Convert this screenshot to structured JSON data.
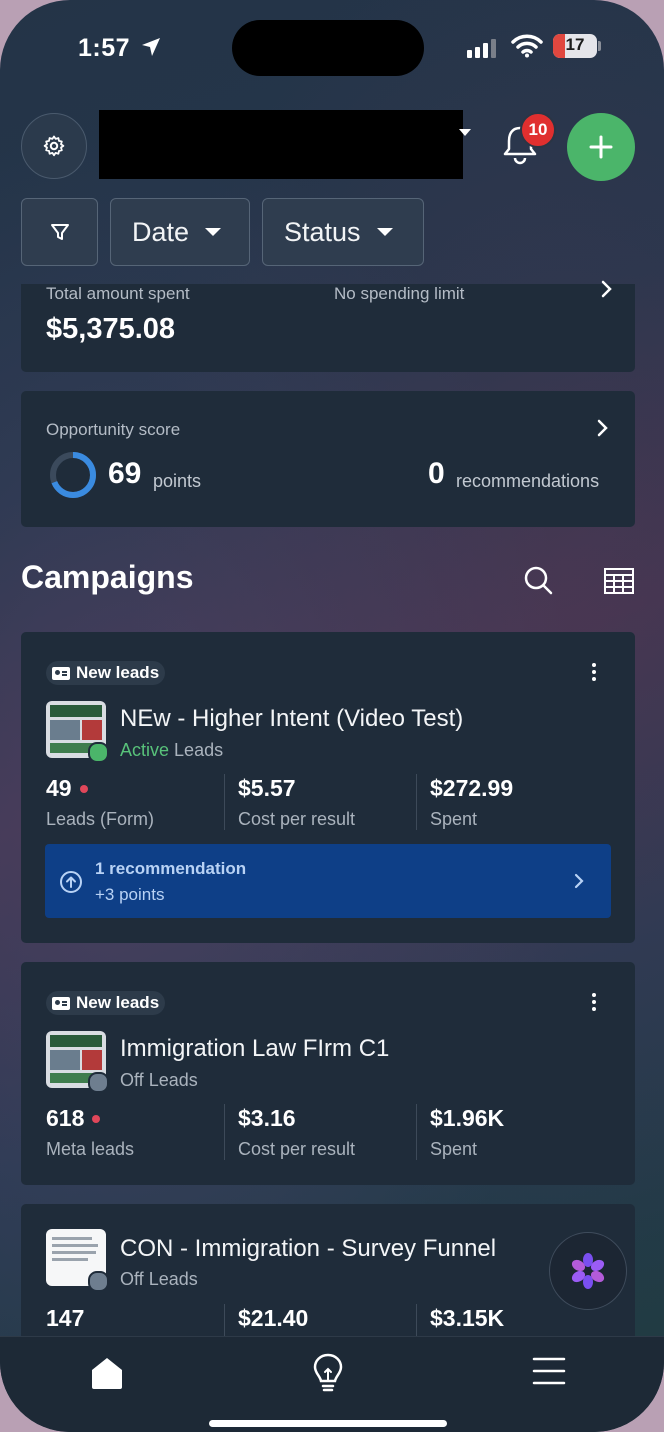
{
  "status_bar": {
    "time": "1:57",
    "battery": "17"
  },
  "header": {
    "notifications_count": "10"
  },
  "filters": {
    "date_label": "Date",
    "status_label": "Status"
  },
  "spending": {
    "total_label": "Total amount spent",
    "total_value": "$5,375.08",
    "limit_label": "No spending limit"
  },
  "opportunity": {
    "label": "Opportunity score",
    "score": "69",
    "score_unit": "points",
    "recommendations_count": "0",
    "recommendations_label": "recommendations",
    "ring_fraction": 0.69
  },
  "campaigns_title": "Campaigns",
  "campaigns": [
    {
      "tag": "New leads",
      "name": "NEw - Higher Intent (Video Test)",
      "status": "Active",
      "objective": "Leads",
      "metrics": [
        {
          "value": "49",
          "label": "Leads (Form)"
        },
        {
          "value": "$5.57",
          "label": "Cost per result"
        },
        {
          "value": "$272.99",
          "label": "Spent"
        }
      ],
      "recommendation": {
        "title": "1 recommendation",
        "points": "+3 points"
      }
    },
    {
      "tag": "New leads",
      "name": "Immigration Law FIrm C1",
      "status": "Off",
      "objective": "Leads",
      "metrics": [
        {
          "value": "618",
          "label": "Meta leads"
        },
        {
          "value": "$3.16",
          "label": "Cost per result"
        },
        {
          "value": "$1.96K",
          "label": "Spent"
        }
      ]
    },
    {
      "name": "CON - Immigration - Survey Funnel",
      "status": "Off",
      "objective": "Leads",
      "metrics": [
        {
          "value": "147"
        },
        {
          "value": "$21.40"
        },
        {
          "value": "$3.15K"
        }
      ]
    }
  ],
  "colors": {
    "accent_green": "#4bb56a",
    "active_green": "#58c27a",
    "badge_red": "#e02f2f",
    "banner_blue": "#0e3f87",
    "card_bg": "#1f2c3a"
  },
  "icons": [
    "location-arrow-icon",
    "signal-icon",
    "wifi-icon",
    "battery-icon",
    "gear-icon",
    "bell-icon",
    "plus-icon",
    "filter-icon",
    "chevron-right-icon",
    "search-icon",
    "table-icon",
    "more-vertical-icon",
    "arrow-up-circle-icon",
    "ai-flower-icon",
    "home-icon",
    "lightbulb-icon",
    "menu-icon"
  ]
}
